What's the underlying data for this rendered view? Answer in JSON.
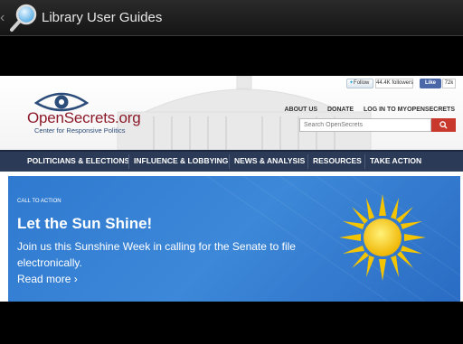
{
  "appbar": {
    "title": "Library User Guides",
    "back_glyph": "‹",
    "icon": "search-magnifier-icon"
  },
  "site": {
    "logo": {
      "name": "OpenSecrets.org",
      "tagline": "Center for Responsive Politics"
    },
    "social": {
      "twitter_label": "Follow",
      "twitter_followers": "44.4K followers",
      "facebook_label": "Like",
      "facebook_count": "72k"
    },
    "util_links": [
      "ABOUT US",
      "DONATE",
      "LOG IN TO MYOPENSECRETS"
    ],
    "search": {
      "placeholder": "Search OpenSecrets"
    },
    "nav": [
      "POLITICIANS & ELECTIONS",
      "INFLUENCE & LOBBYING",
      "NEWS & ANALYSIS",
      "RESOURCES",
      "TAKE ACTION"
    ],
    "banner": {
      "label": "CALL TO ACTION",
      "title": "Let the Sun Shine!",
      "body": "Join us this Sunshine Week in calling for the Senate to file electronically.",
      "link": "Read more ›"
    }
  },
  "colors": {
    "nav_bg": "#2b3a57",
    "banner_bg": "#3580d4",
    "logo_red": "#8c1a2a",
    "search_btn": "#c8382c",
    "sun": "#f5c400"
  }
}
